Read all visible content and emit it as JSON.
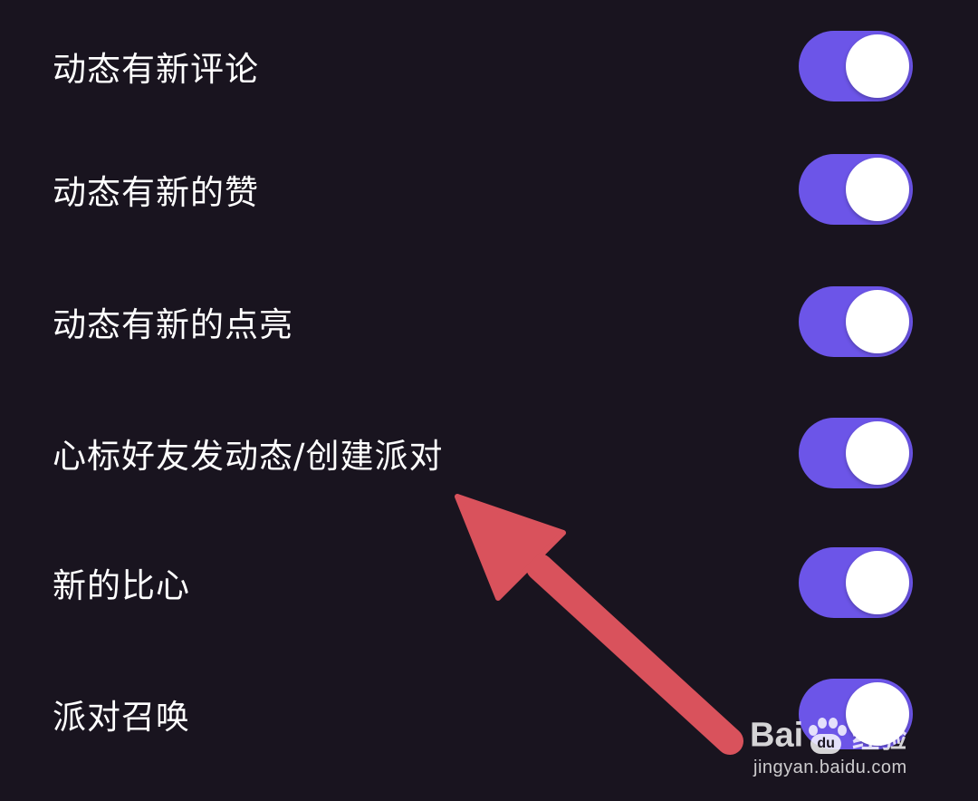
{
  "settings": [
    {
      "label": "动态有新评论",
      "enabled": true
    },
    {
      "label": "动态有新的赞",
      "enabled": true
    },
    {
      "label": "动态有新的点亮",
      "enabled": true
    },
    {
      "label": "心标好友发动态/创建派对",
      "enabled": true
    },
    {
      "label": "新的比心",
      "enabled": true
    },
    {
      "label": "派对召唤",
      "enabled": true
    }
  ],
  "colors": {
    "background": "#19141f",
    "toggle_on": "#6c55e8",
    "toggle_knob": "#ffffff",
    "label_text": "#ffffff",
    "annotation_arrow": "#d9525c"
  },
  "annotation": {
    "icon": "arrow-icon",
    "points_to": "心标好友发动态/创建派对"
  },
  "watermark": {
    "brand_prefix": "Bai",
    "brand_badge": "du",
    "brand_suffix": "经验",
    "url": "jingyan.baidu.com"
  }
}
